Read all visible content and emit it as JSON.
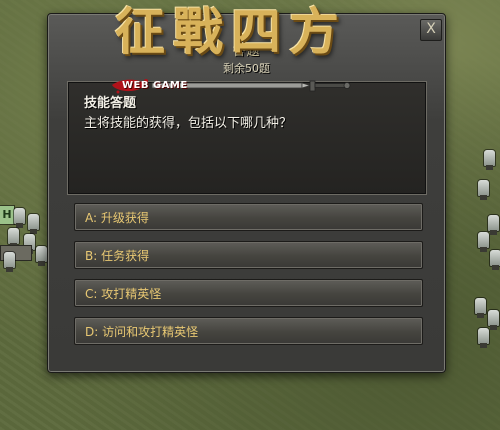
{
  "logo": {
    "title": "征戰四方",
    "tagline": "WEB GAME"
  },
  "dialog": {
    "title": "答题",
    "remaining": "剩余50题",
    "close_symbol": "X",
    "question": {
      "title": "技能答题",
      "text": "主将技能的获得，包括以下哪几种？"
    },
    "options": [
      {
        "label": "A: 升级获得"
      },
      {
        "label": "B: 任务获得"
      },
      {
        "label": "C: 攻打精英怪"
      },
      {
        "label": "D: 访问和攻打精英怪"
      }
    ]
  },
  "background": {
    "flag_label": "H"
  },
  "colors": {
    "option_text": "#e8c873",
    "title_gold": "#d8b25a",
    "splash_red": "#b0121a"
  },
  "icons": {
    "close": "close-icon",
    "sword": "sword-icon",
    "blood": "blood-splash-icon"
  }
}
